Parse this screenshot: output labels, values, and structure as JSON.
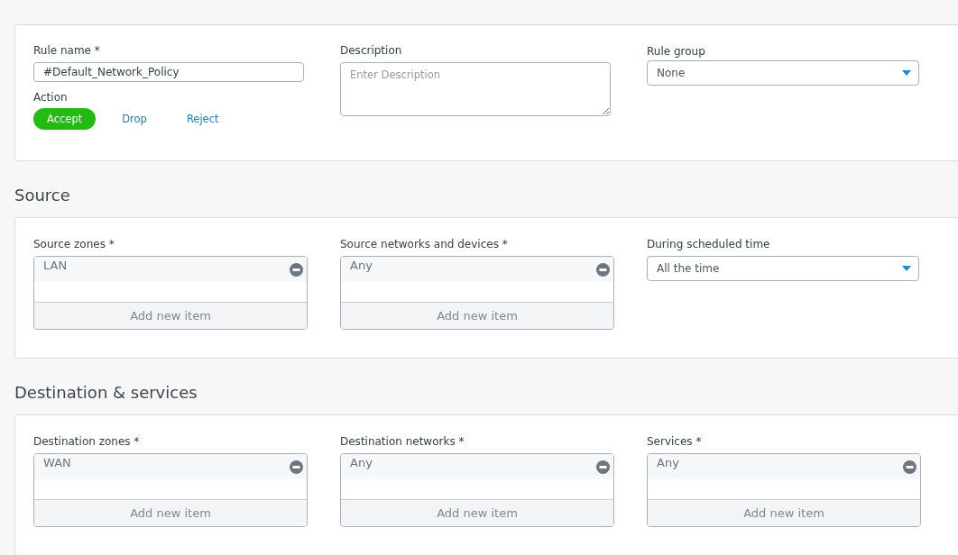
{
  "general": {
    "rule_name": {
      "label": "Rule name *",
      "value": "#Default_Network_Policy"
    },
    "description": {
      "label": "Description",
      "placeholder": "Enter Description"
    },
    "rule_group": {
      "label": "Rule group",
      "value": "None"
    },
    "action": {
      "label": "Action",
      "options": [
        {
          "label": "Accept",
          "selected": true
        },
        {
          "label": "Drop",
          "selected": false
        },
        {
          "label": "Reject",
          "selected": false
        }
      ]
    }
  },
  "sections": [
    {
      "title": "Source",
      "fields": [
        {
          "kind": "list",
          "label": "Source zones *",
          "items": [
            "LAN"
          ],
          "add_label": "Add new item"
        },
        {
          "kind": "list",
          "label": "Source networks and devices *",
          "items": [
            "Any"
          ],
          "add_label": "Add new item"
        },
        {
          "kind": "select",
          "label": "During scheduled time",
          "value": "All the time"
        }
      ]
    },
    {
      "title": "Destination & services",
      "fields": [
        {
          "kind": "list",
          "label": "Destination zones *",
          "items": [
            "WAN"
          ],
          "add_label": "Add new item"
        },
        {
          "kind": "list",
          "label": "Destination networks *",
          "items": [
            "Any"
          ],
          "add_label": "Add new item"
        },
        {
          "kind": "list",
          "label": "Services *",
          "items": [
            "Any"
          ],
          "add_label": "Add new item"
        }
      ]
    }
  ]
}
